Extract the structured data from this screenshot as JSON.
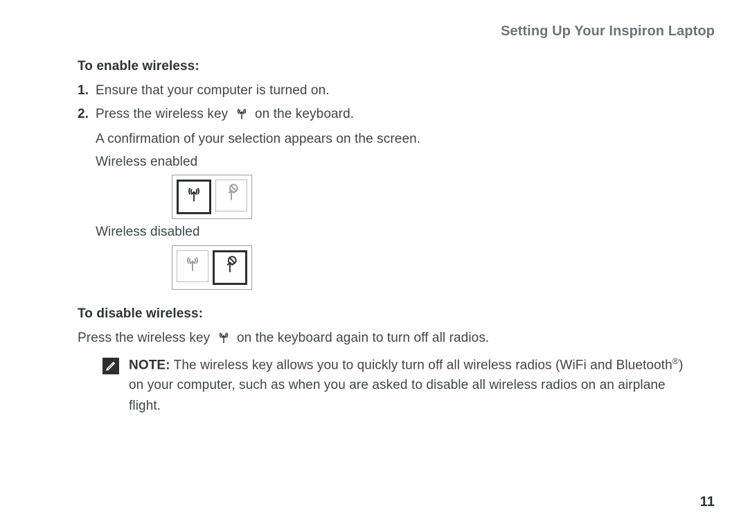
{
  "header": {
    "running_title": "Setting Up Your Inspiron Laptop"
  },
  "enable": {
    "heading": "To enable wireless:",
    "steps": [
      {
        "num": "1.",
        "text": "Ensure that your computer is turned on."
      },
      {
        "num": "2.",
        "text_before": "Press the wireless key ",
        "text_after": " on the keyboard."
      }
    ],
    "confirm": "A confirmation of your selection appears on the screen.",
    "enabled_label": "Wireless enabled",
    "disabled_label": "Wireless disabled"
  },
  "disable": {
    "heading": "To disable wireless:",
    "text_before": "Press the wireless key ",
    "text_after": " on the keyboard again to turn off all radios."
  },
  "note": {
    "label": "NOTE:",
    "body_before": " The wireless key allows you to quickly turn off all wireless radios (WiFi and Bluetooth",
    "reg": "®",
    "body_after": ") on your computer, such as when you are asked to disable all wireless radios on an airplane flight."
  },
  "page_number": "11",
  "icons": {
    "wireless": "wireless-icon",
    "wireless_off": "wireless-disabled-icon",
    "note": "pencil-note-icon"
  }
}
